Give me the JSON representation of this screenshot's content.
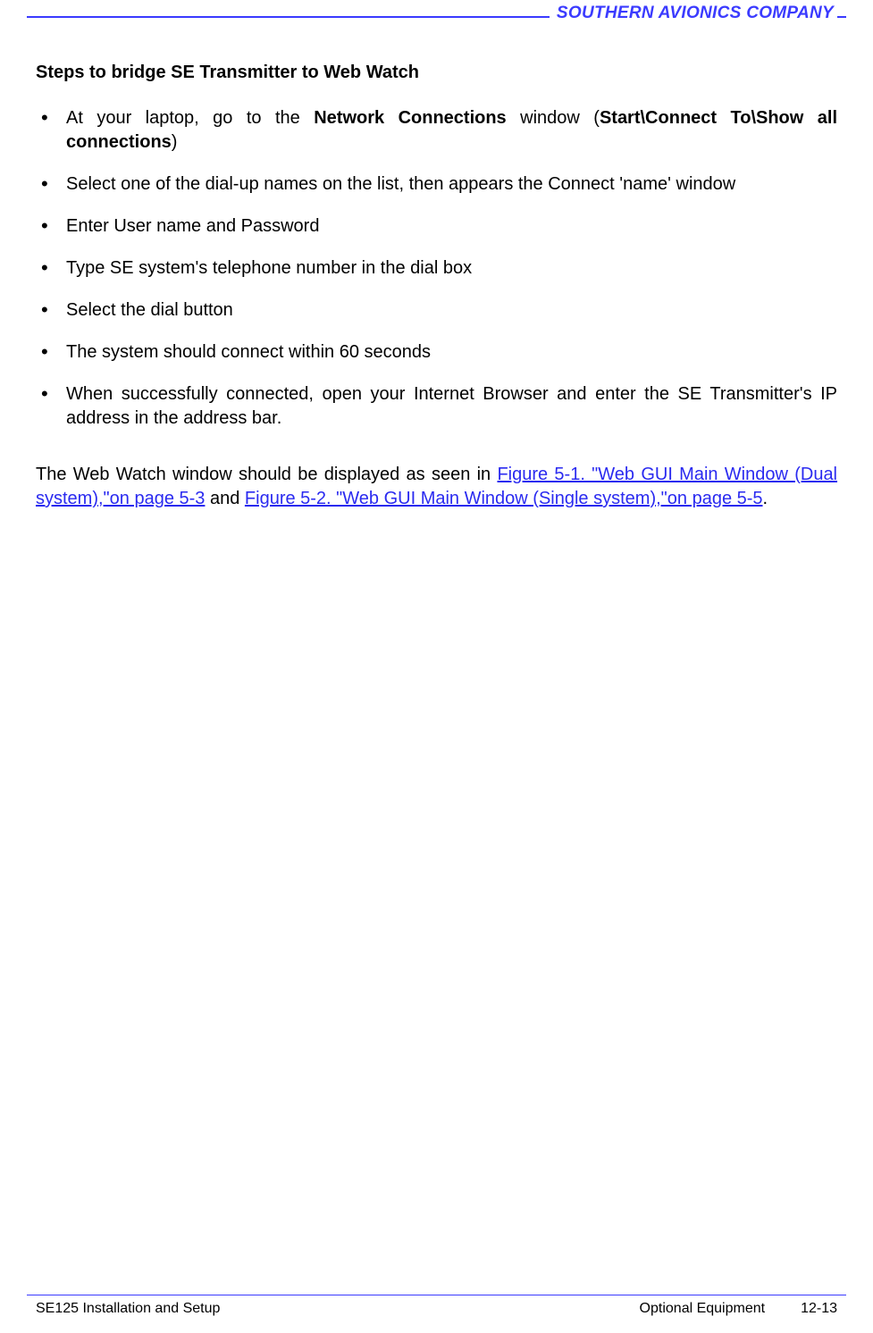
{
  "company_name": "SOUTHERN AVIONICS COMPANY",
  "heading": "Steps to bridge SE Transmitter to Web Watch",
  "bullets": [
    {
      "prefix": "At your laptop, go to the  ",
      "bold1": "Network Connections",
      "mid1": " window (",
      "bold2": "Start\\Connect To\\Show all connections",
      "suffix": ")"
    },
    {
      "text": "Select one of the dial-up names on the list, then appears the Connect 'name' window"
    },
    {
      "text": "Enter User name and Password"
    },
    {
      "text": "Type SE system's telephone number in the dial box"
    },
    {
      "text": "Select the dial button"
    },
    {
      "text": "The system should connect within 60 seconds"
    },
    {
      "text": "When successfully connected, open your Internet Browser and enter the SE Transmitter's IP address in the address bar."
    }
  ],
  "para": {
    "pre": "The Web Watch window should be displayed as seen in ",
    "link1": "Figure 5-1. \"Web GUI Main Window (Dual system),\"on page 5-3",
    "mid": " and ",
    "link2": "Figure 5-2. \"Web GUI Main Window (Single system),\"on page 5-5",
    "post": "."
  },
  "footer": {
    "left": "SE125 Installation and Setup",
    "section": "Optional Equipment",
    "page": "12-13"
  }
}
